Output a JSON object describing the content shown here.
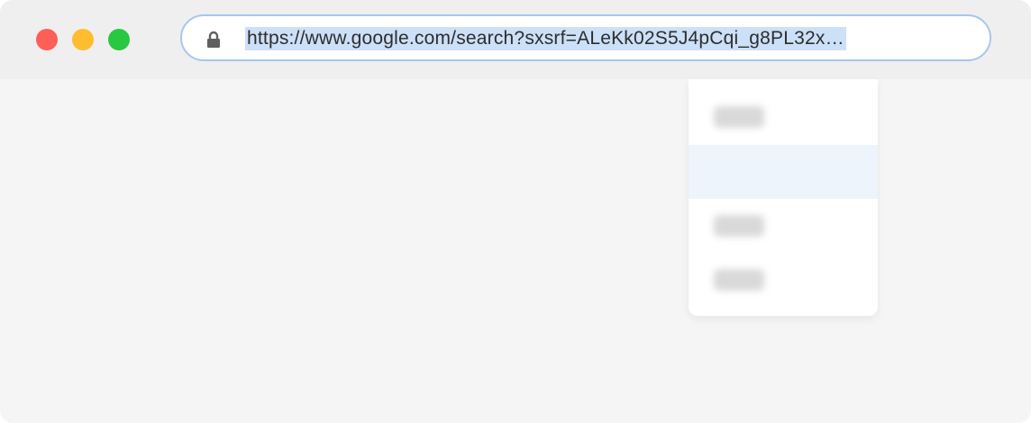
{
  "window": {
    "controls": [
      "close-button",
      "minimize-button",
      "zoom-button"
    ]
  },
  "address_bar": {
    "url": "https://www.google.com/search?sxsrf=ALeKk02S5J4pCqi_g8PL32x…",
    "lock_icon": "lock-icon"
  },
  "dropdown": {
    "items": [
      {
        "state": "normal"
      },
      {
        "state": "highlighted"
      },
      {
        "state": "normal"
      },
      {
        "state": "normal"
      }
    ]
  },
  "colors": {
    "close": "#fe5f57",
    "minimize": "#febc2e",
    "zoom": "#28c840",
    "address_border": "#a7c6ef",
    "selection": "#cce0f8",
    "highlight_row": "#edf4fc"
  }
}
